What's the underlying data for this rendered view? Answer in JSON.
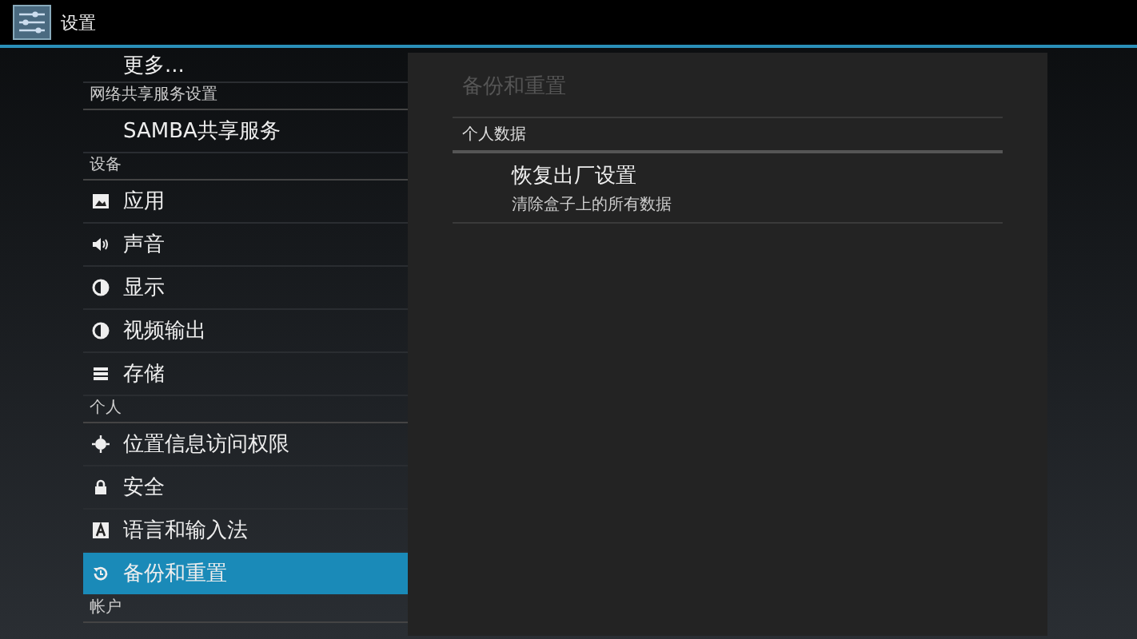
{
  "title_bar": {
    "title": "设置"
  },
  "sidebar": {
    "items": [
      {
        "kind": "item",
        "label": "更多...",
        "selected": false
      },
      {
        "kind": "header",
        "label": "网络共享服务设置"
      },
      {
        "kind": "item",
        "label": "SAMBA共享服务",
        "selected": false
      },
      {
        "kind": "header",
        "label": "设备"
      },
      {
        "kind": "item",
        "label": "应用",
        "selected": false
      },
      {
        "kind": "item",
        "label": "声音",
        "selected": false
      },
      {
        "kind": "item",
        "label": "显示",
        "selected": false
      },
      {
        "kind": "item",
        "label": "视频输出",
        "selected": false
      },
      {
        "kind": "item",
        "label": "存储",
        "selected": false
      },
      {
        "kind": "header",
        "label": "个人"
      },
      {
        "kind": "item",
        "label": "位置信息访问权限",
        "selected": false
      },
      {
        "kind": "item",
        "label": "安全",
        "selected": false
      },
      {
        "kind": "item",
        "label": "语言和输入法",
        "selected": false
      },
      {
        "kind": "item",
        "label": "备份和重置",
        "selected": true
      },
      {
        "kind": "header",
        "label": "帐户"
      }
    ]
  },
  "detail": {
    "title": "备份和重置",
    "section": "个人数据",
    "entries": [
      {
        "title": "恢复出厂设置",
        "summary": "清除盒子上的所有数据"
      }
    ]
  }
}
